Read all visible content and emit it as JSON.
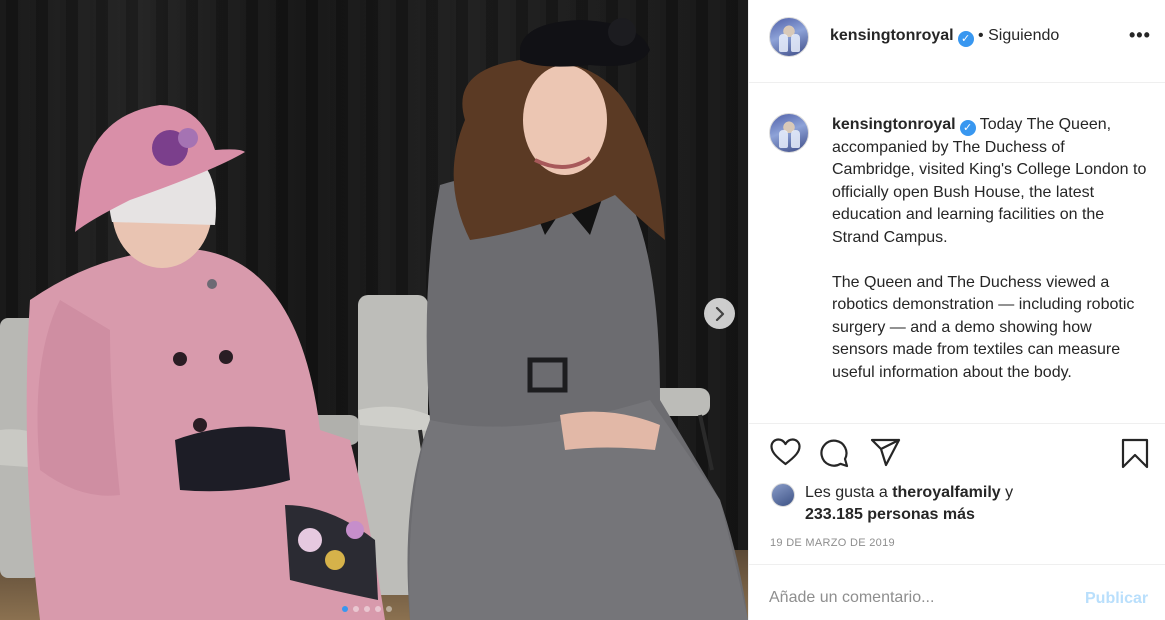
{
  "post": {
    "username": "kensingtonroyal",
    "follow_separator": "•",
    "follow_status": "Siguiendo",
    "more_icon": "more-horizontal-icon",
    "caption_username": "kensingtonroyal",
    "caption_paragraph_1": "Today The Queen, accompanied by The Duchess of Cambridge, visited King's College London to officially open Bush House, the latest education and learning facilities on the Strand Campus.",
    "caption_paragraph_2": "The Queen and The Duchess viewed a robotics demonstration — including robotic surgery — and a demo showing how sensors made from textiles can measure useful information about the body.",
    "likes_prefix": "Les gusta a",
    "likes_user": "theroyalfamily",
    "likes_and": "y",
    "likes_count_text": "233.185 personas más",
    "date": "19 DE MARZO DE 2019",
    "comment_placeholder": "Añade un comentario...",
    "publish_label": "Publicar"
  },
  "carousel": {
    "total_slides": 5,
    "active_slide": 1,
    "next_icon": "chevron-right-icon"
  },
  "icons": {
    "like": "heart-icon",
    "comment": "comment-bubble-icon",
    "share": "paper-plane-icon",
    "save": "bookmark-icon",
    "verified": "verified-badge-icon"
  },
  "colors": {
    "verified": "#3897f0",
    "publish_disabled": "#b9dffc",
    "muted_text": "#8e8e8e",
    "border": "#efefef"
  }
}
